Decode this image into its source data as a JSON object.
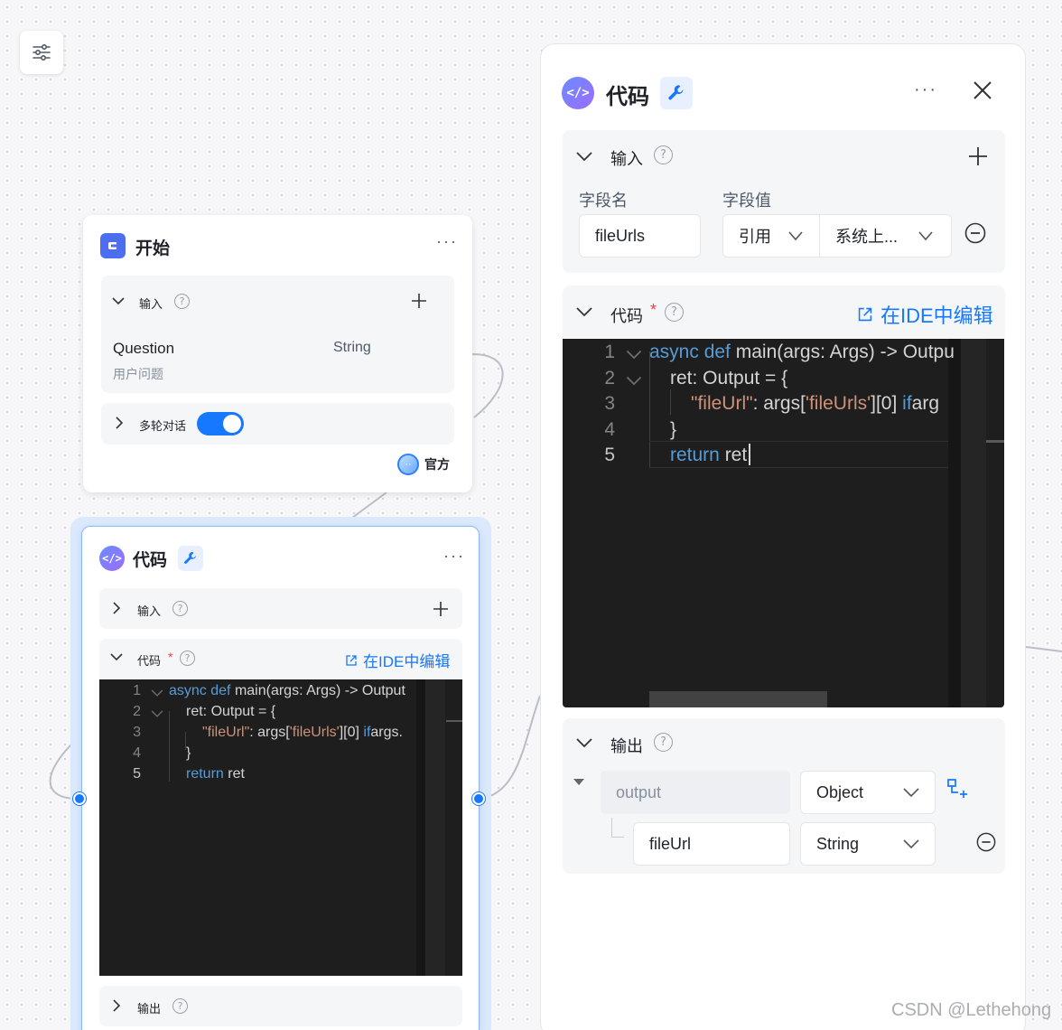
{
  "canvas": {
    "settings_icon": "sliders-icon"
  },
  "start_node": {
    "title": "开始",
    "icon": "start-logo-icon",
    "input_section": {
      "label": "输入",
      "field_name": "Question",
      "field_desc": "用户问题",
      "field_type": "String"
    },
    "multi_turn_label": "多轮对话",
    "multi_turn_enabled": true,
    "official_label": "官方"
  },
  "code_node": {
    "title": "代码",
    "icon": "code-icon",
    "plugin_icon": "wrench-icon",
    "input_label": "输入",
    "code_label": "代码",
    "required_mark": "*",
    "ide_link": "在IDE中编辑",
    "output_label": "输出",
    "code_lines": [
      {
        "n": "1",
        "parts": [
          [
            "kw",
            "async def"
          ],
          [
            "",
            "main(args: Args) -> Output"
          ]
        ]
      },
      {
        "n": "2",
        "parts": [
          [
            "",
            "ret: Output = {"
          ]
        ]
      },
      {
        "n": "3",
        "parts": [
          [
            "str",
            "\"fileUrl\""
          ],
          [
            "",
            ": args["
          ],
          [
            "str",
            "'fileUrls'"
          ],
          [
            "",
            "][0] "
          ],
          [
            "kw",
            "if"
          ],
          [
            "",
            "args."
          ]
        ]
      },
      {
        "n": "4",
        "parts": [
          [
            "",
            "}"
          ]
        ]
      },
      {
        "n": "5",
        "parts": [
          [
            "kw",
            "return"
          ],
          [
            "",
            " ret"
          ]
        ]
      }
    ]
  },
  "panel": {
    "title": "代码",
    "icon": "code-icon",
    "plugin_icon": "wrench-icon",
    "more_label": "···",
    "input_section": {
      "label": "输入",
      "col_name": "字段名",
      "col_value": "字段值",
      "field_name": "fileUrls",
      "ref_type": "引用",
      "ref_value": "系统上..."
    },
    "code_section": {
      "label": "代码",
      "required_mark": "*",
      "ide_link": "在IDE中编辑",
      "lines": [
        {
          "n": "1",
          "parts": [
            [
              "kw",
              "async def"
            ],
            [
              "",
              "main(args: Args) -> Outpu"
            ]
          ]
        },
        {
          "n": "2",
          "parts": [
            [
              "",
              "ret: Output = {"
            ]
          ]
        },
        {
          "n": "3",
          "parts": [
            [
              "str",
              "\"fileUrl\""
            ],
            [
              "",
              ": args["
            ],
            [
              "str",
              "'fileUrls'"
            ],
            [
              "",
              "][0] "
            ],
            [
              "kw",
              "if"
            ],
            [
              "",
              "arg"
            ]
          ]
        },
        {
          "n": "4",
          "parts": [
            [
              "",
              "}"
            ]
          ]
        },
        {
          "n": "5",
          "parts": [
            [
              "kw",
              "return"
            ],
            [
              "",
              " ret"
            ]
          ]
        }
      ]
    },
    "output_section": {
      "label": "输出",
      "root_name": "output",
      "root_type": "Object",
      "child_name": "fileUrl",
      "child_type": "String"
    }
  },
  "watermark": "CSDN @Lethehong"
}
